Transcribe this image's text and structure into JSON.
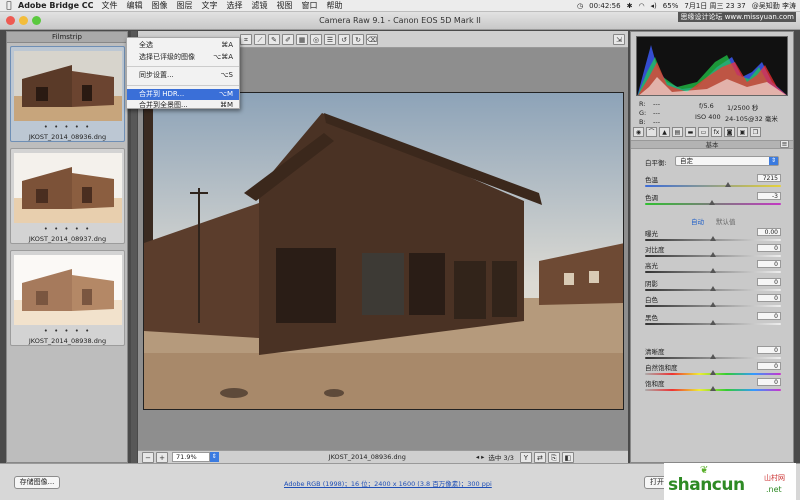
{
  "menubar": {
    "app": "Adobe Bridge CC",
    "menus": [
      "文件",
      "编辑",
      "图像",
      "图层",
      "文字",
      "选择",
      "滤镜",
      "视图",
      "窗口",
      "帮助"
    ],
    "time": "00:42:56",
    "battery": "65%",
    "date": "7月1日 周三 23 37",
    "user": "@吴知勤 李涛",
    "watermark": "思缘设计论坛 www.missyuan.com"
  },
  "window": {
    "title": "Camera Raw 9.1 - Canon EOS 5D Mark II"
  },
  "filmstrip": {
    "title": "Filmstrip",
    "items": [
      {
        "name": "JKOST_2014_08936.dng",
        "dots": "• • • • •"
      },
      {
        "name": "JKOST_2014_08937.dng",
        "dots": "• • • • •"
      },
      {
        "name": "JKOST_2014_08938.dng",
        "dots": "• • • • •"
      }
    ]
  },
  "menu": {
    "items": [
      {
        "label": "全选",
        "shortcut": "⌘A"
      },
      {
        "label": "选择已评级的图像",
        "shortcut": "⌥⌘A"
      },
      {
        "label": "同步设置...",
        "shortcut": "⌥S"
      },
      {
        "label": "合并到 HDR...",
        "shortcut": "⌥M"
      },
      {
        "label": "合并到全景图...",
        "shortcut": "⌘M"
      }
    ]
  },
  "status": {
    "zoom": "71.9%",
    "filename": "JKOST_2014_08936.dng",
    "selected": "选中 3/3"
  },
  "panel": {
    "rgb": {
      "r": "R:",
      "g": "G:",
      "b": "B:",
      "r_val": "---",
      "g_val": "---",
      "b_val": "---"
    },
    "exif": {
      "aperture": "f/5.6",
      "shutter": "1/2500 秒",
      "iso": "ISO 400",
      "lens": "24-105@32 毫米"
    },
    "section": "基本",
    "wb_label": "白平衡:",
    "wb_value": "自定",
    "temp_label": "色温",
    "temp_value": "7215",
    "tint_label": "色调",
    "tint_value": "-3",
    "auto": "自动",
    "default": "默认值",
    "sliders": [
      {
        "label": "曝光",
        "value": "0.00"
      },
      {
        "label": "对比度",
        "value": "0"
      },
      {
        "label": "高光",
        "value": "0"
      },
      {
        "label": "阴影",
        "value": "0"
      },
      {
        "label": "白色",
        "value": "0"
      },
      {
        "label": "黑色",
        "value": "0"
      },
      {
        "label": "清晰度",
        "value": "0"
      },
      {
        "label": "自然饱和度",
        "value": "0"
      },
      {
        "label": "饱和度",
        "value": "0"
      }
    ]
  },
  "bottom": {
    "save": "存储图像...",
    "workflow": "Adobe RGB (1998)；16 位；2400 x 1600 (3.8 百万像素)；300 ppi",
    "open": "打开图像"
  },
  "logo": {
    "text": "shancun",
    "sub": "山村网",
    "net": ".net"
  }
}
